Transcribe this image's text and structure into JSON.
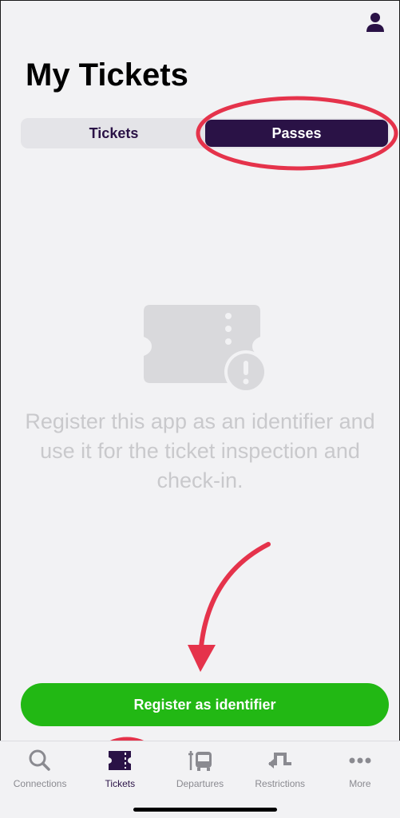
{
  "header": {
    "title": "My Tickets",
    "profile_icon": "person-icon"
  },
  "segments": {
    "tickets_label": "Tickets",
    "passes_label": "Passes",
    "active": "Passes"
  },
  "empty_state": {
    "icon": "ticket-warning-icon",
    "message": "Register this app as an identifier and use it for the ticket inspection and check-in."
  },
  "register_button": {
    "label": "Register as identifier"
  },
  "tabbar": {
    "items": [
      {
        "label": "Connections",
        "icon": "search-icon"
      },
      {
        "label": "Tickets",
        "icon": "ticket-icon"
      },
      {
        "label": "Departures",
        "icon": "bus-departures-icon"
      },
      {
        "label": "Restrictions",
        "icon": "restrictions-icon"
      },
      {
        "label": "More",
        "icon": "more-dots-icon"
      }
    ],
    "active": "Tickets"
  },
  "colors": {
    "brand": "#2a1246",
    "accent_green": "#22b814",
    "annotation_red": "#e5334b",
    "background": "#f2f2f4"
  }
}
